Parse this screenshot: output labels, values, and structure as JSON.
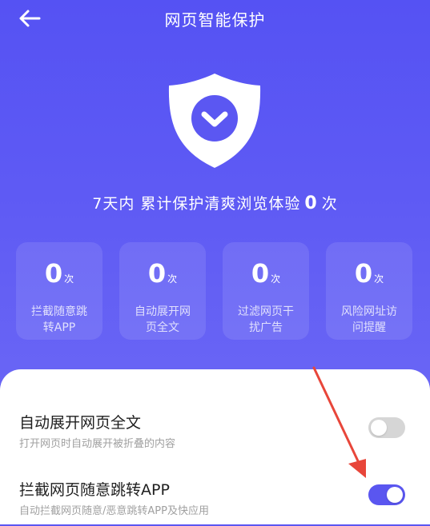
{
  "header": {
    "title": "网页智能保护",
    "back_icon": "arrow-left-icon"
  },
  "hero": {
    "shield_icon": "shield-check-icon",
    "summary_prefix": "7天内  累计保护清爽浏览体验",
    "summary_count": "0",
    "summary_suffix": "次"
  },
  "stats": [
    {
      "value": "0",
      "unit": "次",
      "label": "拦截随意跳转APP"
    },
    {
      "value": "0",
      "unit": "次",
      "label": "自动展开网页全文"
    },
    {
      "value": "0",
      "unit": "次",
      "label": "过滤网页干扰广告"
    },
    {
      "value": "0",
      "unit": "次",
      "label": "风险网址访问提醒"
    }
  ],
  "settings": [
    {
      "title": "自动展开网页全文",
      "desc": "打开网页时自动展开被折叠的内容",
      "enabled": false
    },
    {
      "title": "拦截网页随意跳转APP",
      "desc": "自动拦截网页随意/恶意跳转APP及快应用",
      "enabled": true
    }
  ],
  "colors": {
    "accent": "#5a56f0",
    "annotation_arrow": "#e8463a",
    "toggle_off": "#d6d6d6"
  }
}
